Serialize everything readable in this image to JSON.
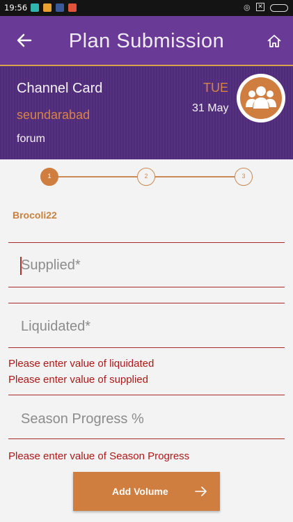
{
  "status_bar": {
    "time": "19:56",
    "notification_icons": [
      "app-icon-cyan",
      "app-icon-orange",
      "facebook-icon",
      "app-icon-red"
    ],
    "right_icons": [
      "hotspot-icon",
      "no-sim-icon",
      "battery-icon"
    ]
  },
  "app_bar": {
    "title": "Plan Submission",
    "back_icon": "arrow-left-icon",
    "home_icon": "home-icon"
  },
  "header": {
    "card_title": "Channel Card",
    "location": "seundarabad",
    "subtitle": "forum",
    "day": "TUE",
    "date": "31 May",
    "avatar_icon": "group-icon"
  },
  "stepper": {
    "steps": [
      "1",
      "2",
      "3"
    ],
    "active_step": 1
  },
  "form": {
    "crop_name": "Brocoli22",
    "supplied": {
      "placeholder": "Supplied*",
      "value": ""
    },
    "liquidated": {
      "placeholder": "Liquidated*",
      "value": ""
    },
    "season_progress": {
      "placeholder": "Season Progress %",
      "value": ""
    },
    "errors": {
      "liquidated": "Please enter value of liquidated",
      "supplied": "Please enter value of supplied",
      "season_progress": "Please enter value of Season Progress"
    }
  },
  "actions": {
    "add_volume_label": "Add Volume",
    "add_volume_icon": "arrow-right-icon"
  },
  "colors": {
    "app_bar": "#6a3a97",
    "header": "#4f2c79",
    "accent": "#d07e40",
    "error": "#b01818",
    "divider": "#a82a2a"
  }
}
